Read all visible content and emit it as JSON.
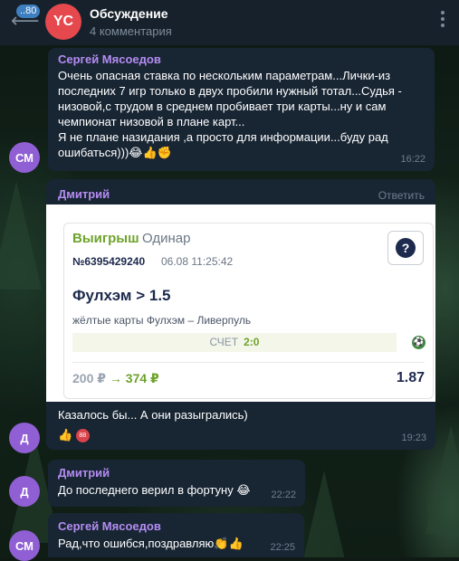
{
  "header": {
    "back_count": "..80",
    "avatar_initials": "YC",
    "title": "Обсуждение",
    "subtitle": "4 комментария"
  },
  "messages": [
    {
      "avatar": "СМ",
      "author": "Сергей Мясоедов",
      "lines": [
        "Очень опасная ставка по нескольким параметрам...Лички-из",
        "последних 7 игр только в двух пробили нужный тотал...Судья -",
        "низовой,с трудом в среднем пробивает три карты...ну и сам",
        "чемпионат низовой в плане карт...",
        "Я не плане назидания ,а просто для информации...буду рад",
        "ошибаться)))😂👍✊"
      ],
      "time": "16:22"
    },
    {
      "avatar": "Д",
      "author": "Дмитрий",
      "reply_label": "Ответить",
      "card": {
        "status": "Выигрыш",
        "bet_type": "Одинар",
        "bet_number": "№6395429240",
        "datetime": "06.08 11:25:42",
        "selection": "Фулхэм > 1.5",
        "event": "жёлтые карты Фулхэм – Ливерпуль",
        "score_label": "СЧЕТ",
        "score": "2:0",
        "stake": "200 ₽",
        "arrow": "→",
        "payout": "374 ₽",
        "odds": "1.87",
        "help_glyph": "?"
      },
      "text": "Казалось бы... А они разыгрались)",
      "reactions": {
        "emoji": "👍",
        "count": "88"
      },
      "time": "19:23"
    },
    {
      "avatar": "Д",
      "author": "Дмитрий",
      "text": "До последнего верил в фортуну 😂",
      "time": "22:22"
    },
    {
      "avatar": "СМ",
      "author": "Сергей Мясоедов",
      "text": "Рад,что ошибся,поздравляю👏👍",
      "time": "22:25"
    }
  ],
  "colors": {
    "header_bg": "#17212b",
    "bubble_bg": "#182533",
    "author": "#b48cf2",
    "win_green": "#6ea32a",
    "avatar_purple": "#8f5fd3",
    "channel_avatar_red": "#e5484d"
  }
}
